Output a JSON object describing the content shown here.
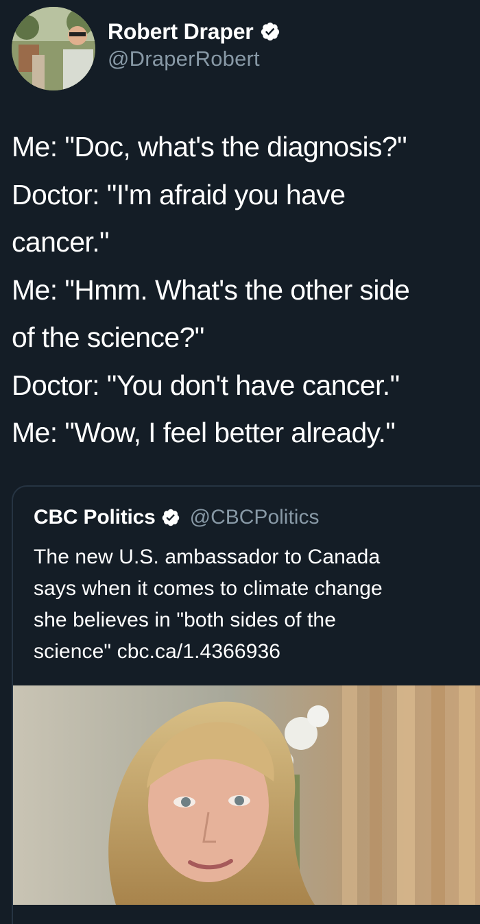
{
  "author": {
    "display_name": "Robert Draper",
    "handle": "@DraperRobert",
    "verified_icon": "verified-badge-icon"
  },
  "tweet": {
    "lines": [
      "Me: \"Doc, what's the diagnosis?\"",
      "Doctor: \"I'm afraid you have",
      "cancer.\"",
      "Me: \"Hmm. What's the other side",
      "of the science?\"",
      "Doctor: \"You don't have cancer.\"",
      "Me: \"Wow, I feel better already.\""
    ]
  },
  "quoted_tweet": {
    "display_name": "CBC Politics",
    "handle": "@CBCPolitics",
    "verified_icon": "verified-badge-icon",
    "lines": [
      "The new U.S. ambassador to Canada",
      "says when it comes to climate change",
      "she believes in \"both sides of the",
      "science\" cbc.ca/1.4366936"
    ],
    "image_icon": "ambassador-photo"
  },
  "colors": {
    "background": "#141d26",
    "primary_text": "#ffffff",
    "secondary_text": "#8899a6",
    "card_border": "#263442"
  }
}
